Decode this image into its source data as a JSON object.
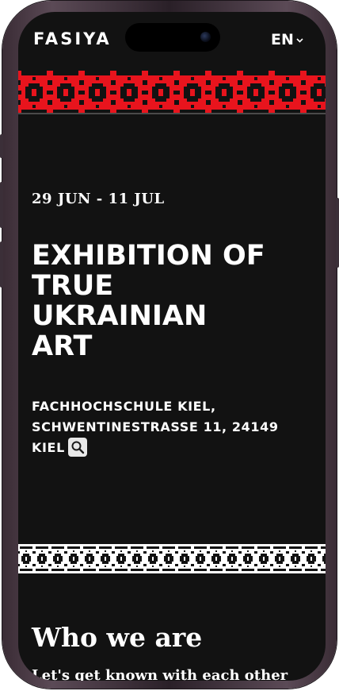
{
  "header": {
    "logo": "FASIYA",
    "language": "EN"
  },
  "event": {
    "dates": "29 JUN - 11 JUL",
    "title": "EXHIBITION OF TRUE UKRAINIAN ART",
    "address": "FACHHOCHSCHULE KIEL, SCHWENTINESTRASSE 11, 24149 KIEL"
  },
  "about": {
    "heading": "Who we are",
    "intro": "Let's get known with each other"
  },
  "colors": {
    "background": "#121212",
    "accent_red": "#e8141d",
    "text": "#ffffff"
  },
  "icons": {
    "language_toggle": "chevron-down-icon",
    "address_search": "search-icon"
  }
}
